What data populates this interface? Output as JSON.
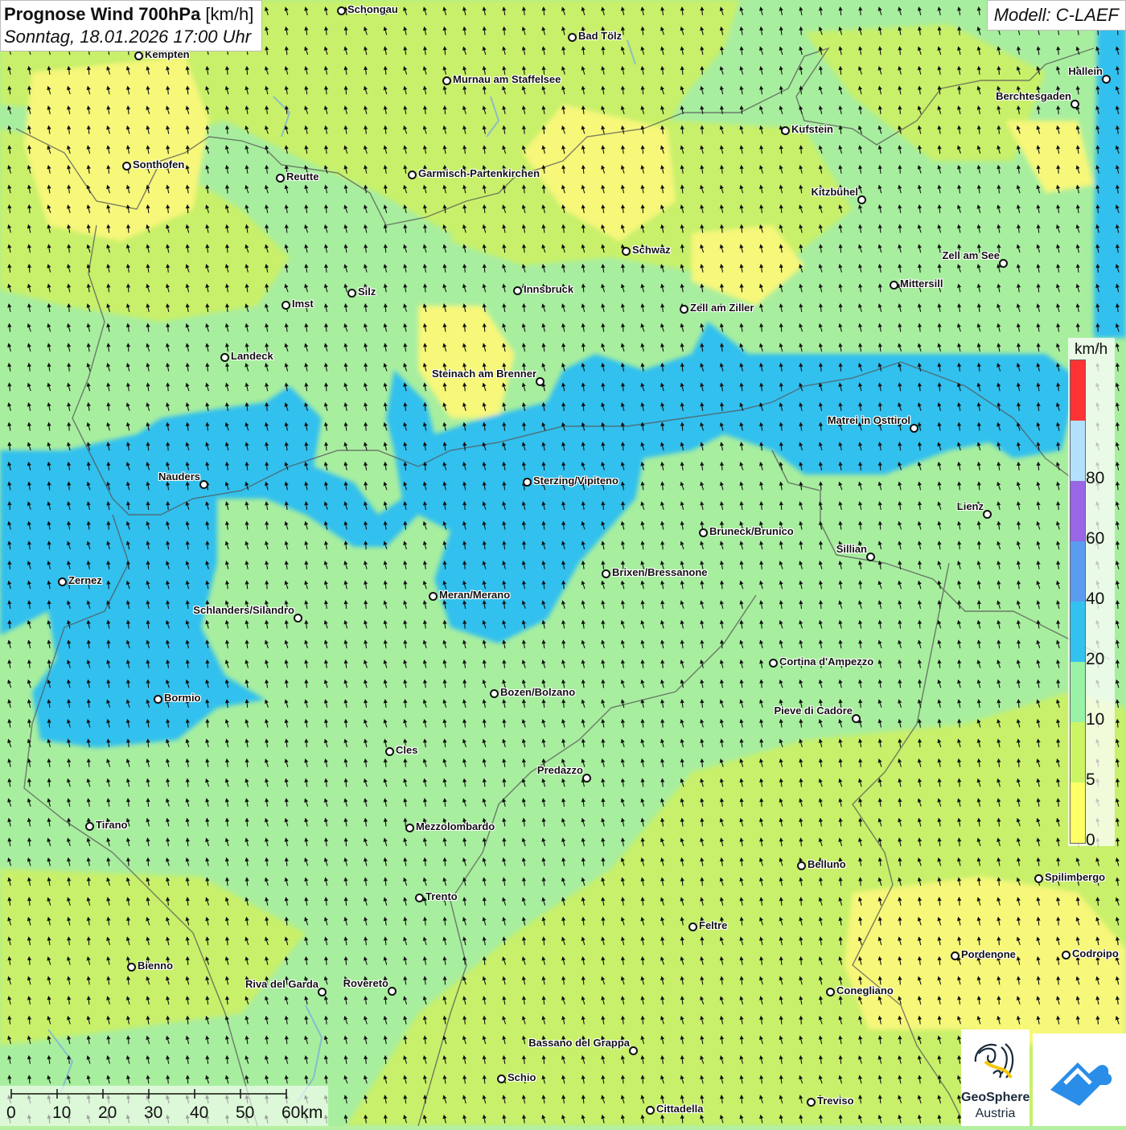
{
  "title": {
    "bold": "Prognose Wind 700hPa",
    "unit": " [km/h]",
    "datetime": "Sonntag, 18.01.2026 17:00 Uhr"
  },
  "model": "Modell: C-LAEF",
  "legend": {
    "unit": "km/h",
    "ticks": [
      "0",
      "5",
      "10",
      "20",
      "40",
      "60",
      "80"
    ],
    "colors": [
      "#ffff66",
      "#ccf566",
      "#99f2a6",
      "#33c2f0",
      "#5c9cf0",
      "#9966e6",
      "#b3e0ff",
      "#ff3333"
    ]
  },
  "scale": {
    "labels": [
      "0",
      "10",
      "20",
      "30",
      "40",
      "50",
      "60km"
    ]
  },
  "logo": {
    "name_line1": "GeoSphere",
    "name_line2": "Austria"
  },
  "wind_direction": "south-southwest to north-northeast",
  "cities": [
    {
      "name": "Schongau"
    },
    {
      "name": "Bad Tölz"
    },
    {
      "name": "Kempten"
    },
    {
      "name": "Murnau am Staffelsee"
    },
    {
      "name": "Hallein"
    },
    {
      "name": "Berchtesgaden"
    },
    {
      "name": "Kufstein"
    },
    {
      "name": "Sonthofen"
    },
    {
      "name": "Reutte"
    },
    {
      "name": "Garmisch-Partenkirchen"
    },
    {
      "name": "Kitzbühel"
    },
    {
      "name": "Schwaz"
    },
    {
      "name": "Zell am See"
    },
    {
      "name": "Innsbruck"
    },
    {
      "name": "Mittersill"
    },
    {
      "name": "Imst"
    },
    {
      "name": "Silz"
    },
    {
      "name": "Zell am Ziller"
    },
    {
      "name": "Landeck"
    },
    {
      "name": "Steinach am Brenner"
    },
    {
      "name": "Matrei in Osttirol"
    },
    {
      "name": "Nauders"
    },
    {
      "name": "Sterzing/Vipiteno"
    },
    {
      "name": "Lienz"
    },
    {
      "name": "Bruneck/Brunico"
    },
    {
      "name": "Sillian"
    },
    {
      "name": "Zernez"
    },
    {
      "name": "Brixen/Bressanone"
    },
    {
      "name": "Meran/Merano"
    },
    {
      "name": "Schlanders/Silandro"
    },
    {
      "name": "Cortina d'Ampezzo"
    },
    {
      "name": "Bormio"
    },
    {
      "name": "Bozen/Bolzano"
    },
    {
      "name": "Pieve di Cadore"
    },
    {
      "name": "Cles"
    },
    {
      "name": "Predazzo"
    },
    {
      "name": "Tirano"
    },
    {
      "name": "Mezzolombardo"
    },
    {
      "name": "Belluno"
    },
    {
      "name": "Spilimbergo"
    },
    {
      "name": "Trento"
    },
    {
      "name": "Feltre"
    },
    {
      "name": "Bienno"
    },
    {
      "name": "Pordenone"
    },
    {
      "name": "Codroipo"
    },
    {
      "name": "Riva del Garda"
    },
    {
      "name": "Rovereto"
    },
    {
      "name": "Conegliano"
    },
    {
      "name": "Bassano del Grappa"
    },
    {
      "name": "Schio"
    },
    {
      "name": "Treviso"
    },
    {
      "name": "Cittadella"
    }
  ]
}
